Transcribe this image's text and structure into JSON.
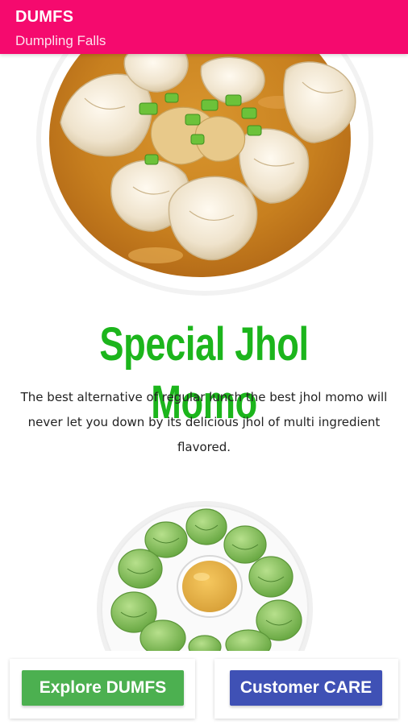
{
  "appbar": {
    "title": "DUMFS",
    "subtitle": "Dumpling Falls",
    "color": "#f50a6e"
  },
  "hero": {
    "image_name": "jhol-momo-bowl-image"
  },
  "feature": {
    "headline": "Special Jhol Momo",
    "headline_color": "#1cb51c",
    "description": "The best alternative of regular lunch the best jhol momo will never let you down by its delicious jhol of multi ingredient flavored."
  },
  "secondary_image": {
    "image_name": "green-momo-plate-image"
  },
  "actions": {
    "explore_label": "Explore DUMFS",
    "explore_color": "#4cb050",
    "care_label": "Customer CARE",
    "care_color": "#3f51b5"
  }
}
